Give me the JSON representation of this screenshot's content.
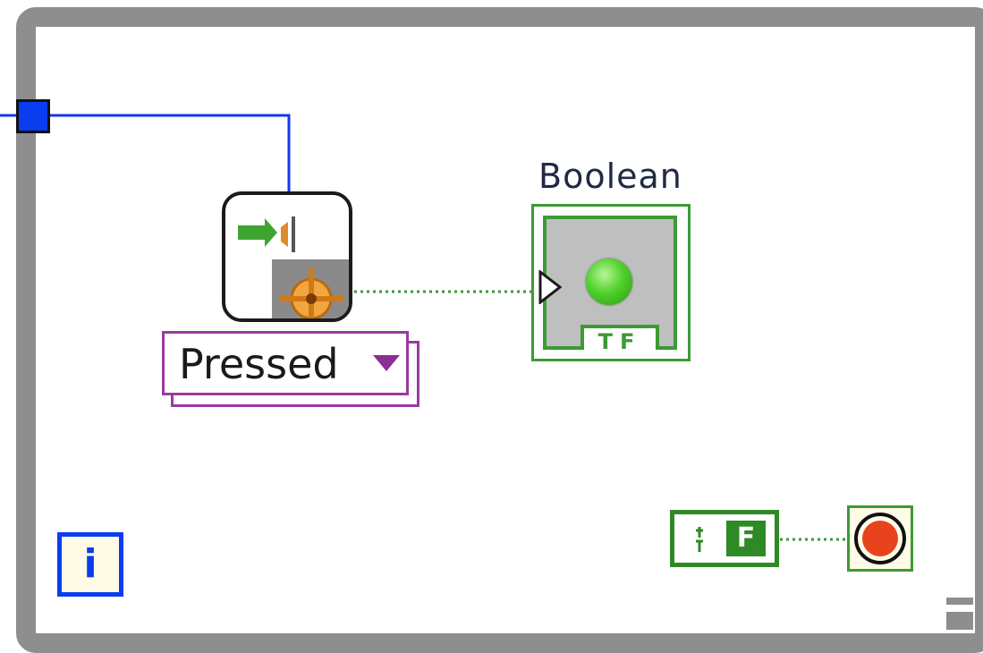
{
  "diagram": {
    "enum_control": {
      "value": "Pressed"
    },
    "boolean_indicator": {
      "label": "Boolean",
      "tf_text": "TF",
      "led_state": "on"
    },
    "false_constant": {
      "letter": "F"
    },
    "iteration_terminal": {
      "letter": "i"
    },
    "colors": {
      "loop_frame": "#8e8e8e",
      "wire_reference": "#0a3df0",
      "wire_boolean": "#3d9a35",
      "enum_border": "#9a3aa0",
      "stop_button": "#e8431d"
    },
    "icons": {
      "property_node": "event-property-node-icon",
      "stop": "stop-condition-icon"
    }
  }
}
